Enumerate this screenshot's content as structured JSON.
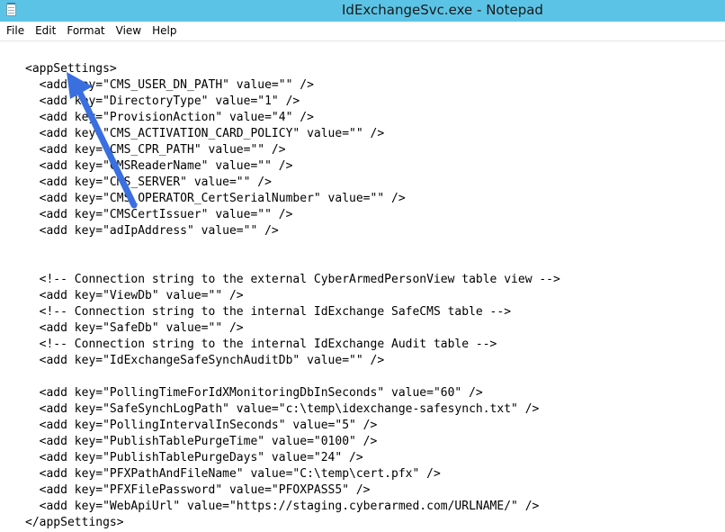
{
  "window": {
    "title": "IdExchangeSvc.exe - Notepad",
    "app_icon": "notepad-icon"
  },
  "menu": {
    "items": [
      "File",
      "Edit",
      "Format",
      "View",
      "Help"
    ]
  },
  "document": {
    "lines": [
      "<appSettings>",
      "  <add key=\"CMS_USER_DN_PATH\" value=\"\" />",
      "  <add key=\"DirectoryType\" value=\"1\" />",
      "  <add key=\"ProvisionAction\" value=\"4\" />",
      "  <add key=\"CMS_ACTIVATION_CARD_POLICY\" value=\"\" />",
      "  <add key=\"CMS_CPR_PATH\" value=\"\" />",
      "  <add key=\"CMSReaderName\" value=\"\" />",
      "  <add key=\"CMS_SERVER\" value=\"\" />",
      "  <add key=\"CMS_OPERATOR_CertSerialNumber\" value=\"\" />",
      "  <add key=\"CMSCertIssuer\" value=\"\" />",
      "  <add key=\"adIpAddress\" value=\"\" />",
      "",
      "",
      "  <!-- Connection string to the external CyberArmedPersonView table view -->",
      "  <add key=\"ViewDb\" value=\"\" />",
      "  <!-- Connection string to the internal IdExchange SafeCMS table -->",
      "  <add key=\"SafeDb\" value=\"\" />",
      "  <!-- Connection string to the internal IdExchange Audit table -->",
      "  <add key=\"IdExchangeSafeSynchAuditDb\" value=\"\" />",
      "",
      "  <add key=\"PollingTimeForIdXMonitoringDbInSeconds\" value=\"60\" />",
      "  <add key=\"SafeSynchLogPath\" value=\"c:\\temp\\idexchange-safesynch.txt\" />",
      "  <add key=\"PollingIntervalInSeconds\" value=\"5\" />",
      "  <add key=\"PublishTablePurgeTime\" value=\"0100\" />",
      "  <add key=\"PublishTablePurgeDays\" value=\"24\" />",
      "  <add key=\"PFXPathAndFileName\" value=\"C:\\temp\\cert.pfx\" />",
      "  <add key=\"PFXFilePassword\" value=\"PFOXPASS5\" />",
      "  <add key=\"WebApiUrl\" value=\"https://staging.cyberarmed.com/URLNAME/\" />",
      "</appSettings>"
    ]
  },
  "annotation": {
    "icon": "arrow-icon",
    "color": "#3a6fe0"
  },
  "colors": {
    "titlebar": "#5bc4e6"
  }
}
